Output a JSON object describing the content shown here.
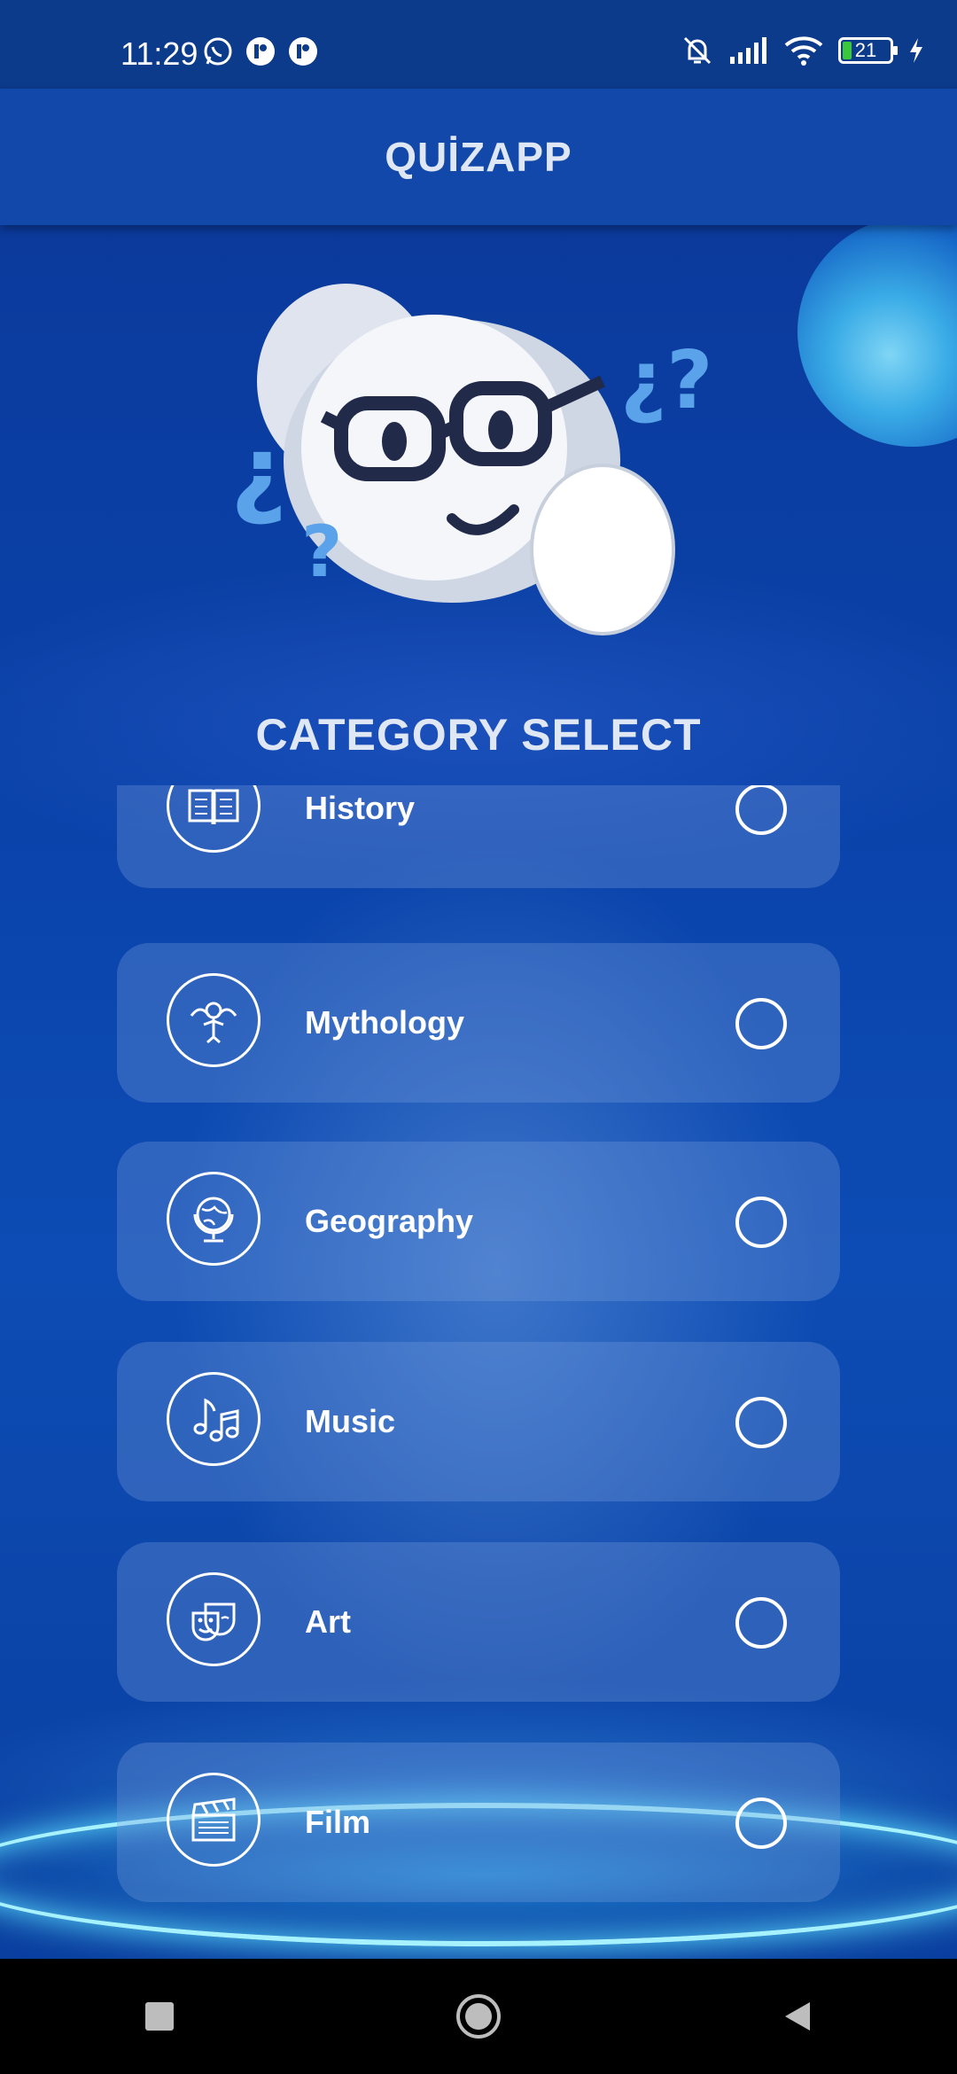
{
  "status_bar": {
    "time": "11:29",
    "left_icons": [
      "whatsapp-icon",
      "app-notification-icon",
      "app-notification-icon"
    ],
    "right_icons": [
      "mute-icon",
      "signal-icon",
      "wifi-icon",
      "battery-icon",
      "charging-icon"
    ],
    "battery_level": "21"
  },
  "app_bar": {
    "title": "QUİZAPP"
  },
  "header": {
    "title": "CATEGORY SELECT"
  },
  "categories": [
    {
      "label": "History",
      "icon": "book-icon",
      "selected": false
    },
    {
      "label": "Mythology",
      "icon": "mythology-icon",
      "selected": false
    },
    {
      "label": "Geography",
      "icon": "globe-icon",
      "selected": false
    },
    {
      "label": "Music",
      "icon": "music-notes-icon",
      "selected": false
    },
    {
      "label": "Art",
      "icon": "theater-masks-icon",
      "selected": false
    },
    {
      "label": "Film",
      "icon": "clapperboard-icon",
      "selected": false
    }
  ],
  "nav_bar": [
    "recents-button",
    "home-button",
    "back-button"
  ],
  "colors": {
    "accent": "#1148a9",
    "background": "#0a3a9a",
    "card": "#7aa0dc"
  }
}
